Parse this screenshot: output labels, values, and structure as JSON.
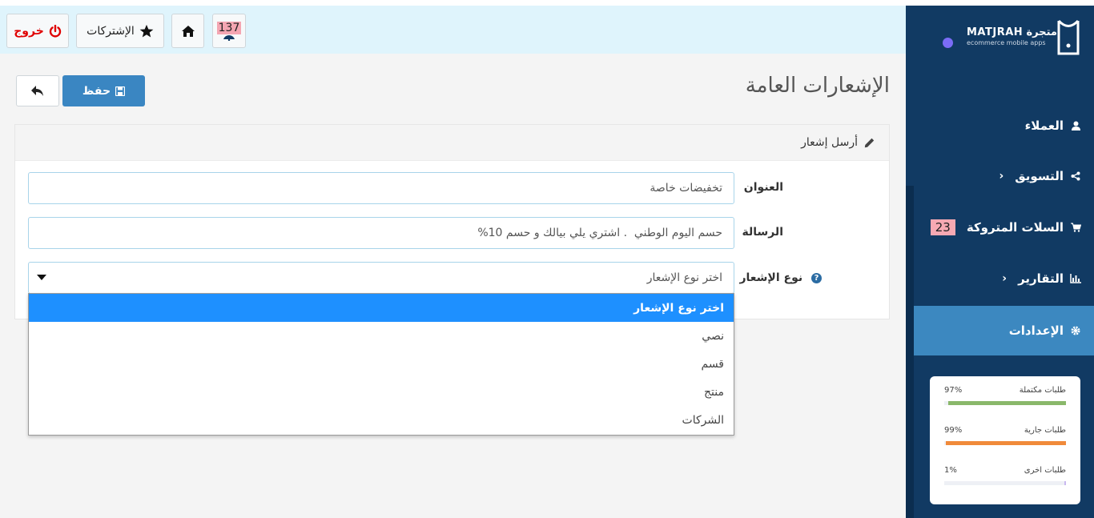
{
  "header": {
    "logout_label": "خروج",
    "subscriptions_label": "الإشتركات",
    "notifications_count": "137"
  },
  "sidebar": {
    "brand": "MATJRAH",
    "brand_arabic": "متجرة",
    "brand_tagline": "ecommerce mobile apps",
    "items": [
      {
        "label": "العملاء"
      },
      {
        "label": "التسويق"
      },
      {
        "label": "السلات المتروكة",
        "badge": "23"
      },
      {
        "label": "التقارير"
      },
      {
        "label": "الإعدادات"
      }
    ],
    "stats": [
      {
        "label": "طلبات مكتملة",
        "value": "97%",
        "color": "#8ab86a",
        "fraction": 0.97
      },
      {
        "label": "طلبات جارية",
        "value": "99%",
        "color": "#f08a3a",
        "fraction": 0.99
      },
      {
        "label": "طلبات اخرى",
        "value": "1%",
        "color": "#c9b8f0",
        "fraction": 0.01
      }
    ]
  },
  "page": {
    "title": "الإشعارات العامة",
    "save_label": "حفظ"
  },
  "panel": {
    "heading": "أرسل إشعار",
    "title_label": "العنوان",
    "title_value": "تخفيضات خاصة",
    "message_label": "الرسالة",
    "message_value": "حسم اليوم الوطني  . اشتري يلي بيالك و حسم 10%",
    "type_label": "نوع الإشعار",
    "type_selected": "اختر نوع الإشعار",
    "type_options": [
      "اختر نوع الإشعار",
      "نصي",
      "قسم",
      "منتج",
      "الشركات"
    ]
  },
  "colors": {
    "header_bg": "#dff4fc",
    "sidebar_bg": "#113a63",
    "sidebar_active": "#3c88c0",
    "primary_button": "#3a86c2",
    "logout_text": "#e00000",
    "option_highlight": "#1e90ff"
  }
}
